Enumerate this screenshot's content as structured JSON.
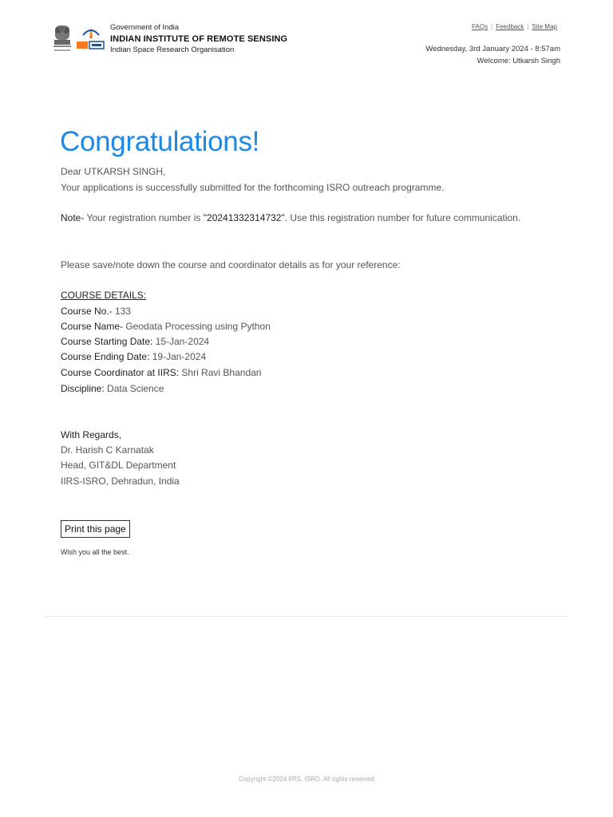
{
  "header": {
    "org_line1": "Government of India",
    "org_line2": "INDIAN INSTITUTE OF REMOTE SENSING",
    "org_line3": "Indian Space Research Organisation",
    "links": [
      "FAQs",
      "Feedback",
      "Site Map"
    ],
    "datetime": "Wednesday, 3rd January 2024 - 8:57am",
    "welcome": "Welcome: Utkarsh Singh"
  },
  "main": {
    "title": "Congratulations!",
    "greeting": "Dear UTKARSH SINGH,",
    "message": "Your applications is successfully submitted for the forthcoming ISRO outreach programme.",
    "note_label": "Note-",
    "note_pre": " Your registration number is ",
    "registration_number": "\"20241332314732\"",
    "note_post": ". Use this registration number for future communication.",
    "save_note": "Please save/note down the course and coordinator details as for your reference:",
    "course_heading": "COURSE DETAILS:",
    "course": [
      {
        "label": "Course No.-",
        "value": " 133"
      },
      {
        "label": "Course Name-",
        "value": " Geodata Processing using Python"
      },
      {
        "label": "Course Starting Date:",
        "value": " 15-Jan-2024"
      },
      {
        "label": "Course Ending Date:",
        "value": " 19-Jan-2024"
      },
      {
        "label": "Course Coordinator at IIRS:",
        "value": " Shri Ravi Bhandari"
      },
      {
        "label": "Discipline:",
        "value": " Data Science"
      }
    ],
    "regards": "With Regards,",
    "signatory_name": "Dr. Harish C Karnatak",
    "signatory_title": "Head, GIT&DL Department",
    "signatory_org": "IIRS-ISRO, Dehradun, India",
    "print_button": "Print this page",
    "wish": "Wish you all the best."
  },
  "footer": {
    "copyright": "Copyright ©2024 IIRS, ISRO. All rights reserved"
  },
  "colors": {
    "title": "#1e88e5",
    "isro_orange": "#f47a20",
    "isro_blue": "#1b4fa0"
  }
}
